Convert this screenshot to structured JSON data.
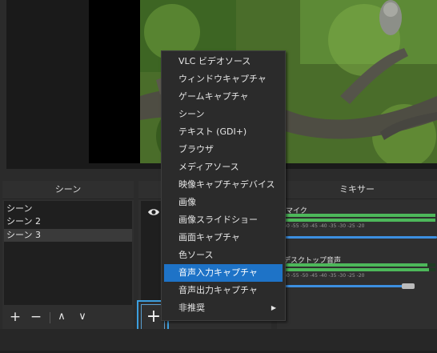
{
  "docks": {
    "scenes_title": "シーン",
    "mixer_title": "ミキサー"
  },
  "scenes": {
    "items": [
      "シーン",
      "シーン 2",
      "シーン 3"
    ],
    "selected_index": 2,
    "toolbar": {
      "add": "+",
      "remove": "−",
      "up": "∧",
      "down": "∨"
    }
  },
  "sources": {
    "add_button": "+"
  },
  "context_menu": {
    "items": [
      "VLC ビデオソース",
      "ウィンドウキャプチャ",
      "ゲームキャプチャ",
      "シーン",
      "テキスト (GDI+)",
      "ブラウザ",
      "メディアソース",
      "映像キャプチャデバイス",
      "画像",
      "画像スライドショー",
      "画面キャプチャ",
      "色ソース",
      "音声入力キャプチャ",
      "音声出力キャプチャ",
      "非推奨"
    ],
    "highlighted_index": 12,
    "submenu_index": 14
  },
  "mixer": {
    "channels": [
      {
        "name": "マイク",
        "meter_level": 1.0,
        "slider_value": 1.0
      },
      {
        "name": "デスクトップ音声",
        "meter_level": 0.95,
        "slider_value": 0.85
      }
    ],
    "ticks": "-60   -55   -50   -45   -40   -35   -30   -25   -20"
  },
  "colors": {
    "accent": "#1e73c7",
    "meter_green": "#4db85a",
    "focus_border": "#3c9fdf"
  }
}
